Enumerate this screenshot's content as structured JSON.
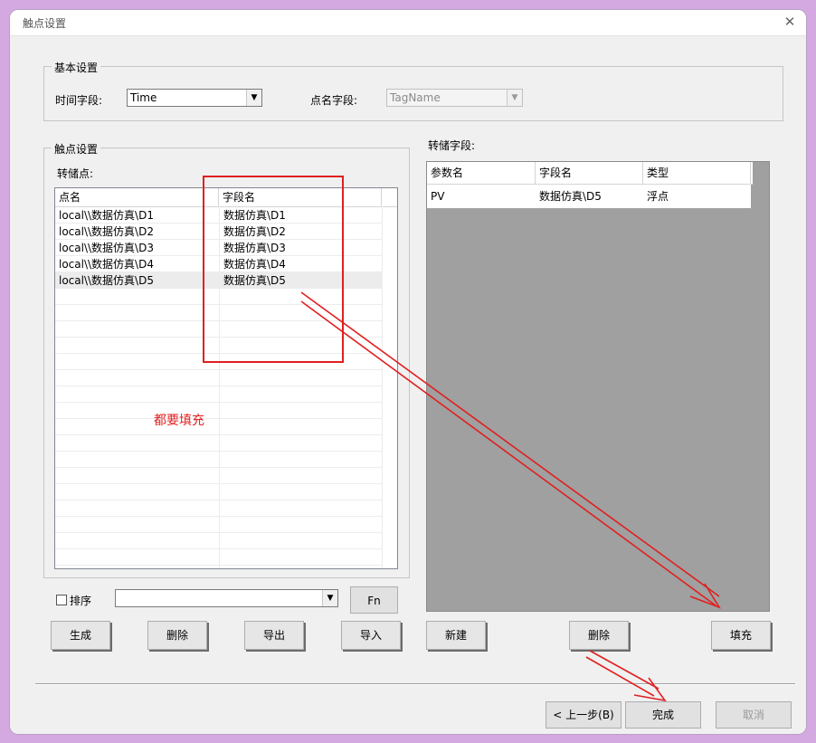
{
  "window": {
    "title": "触点设置",
    "close_glyph": "✕"
  },
  "basic": {
    "group_label": "基本设置",
    "time_field_label": "时间字段:",
    "time_field_value": "Time",
    "point_name_label": "点名字段:",
    "point_name_value": "TagName"
  },
  "points": {
    "group_label": "触点设置",
    "transfer_label": "转储点:",
    "columns": [
      "点名",
      "字段名"
    ],
    "rows": [
      {
        "name": "local\\\\数据仿真\\D1",
        "field": "数据仿真\\D1"
      },
      {
        "name": "local\\\\数据仿真\\D2",
        "field": "数据仿真\\D2"
      },
      {
        "name": "local\\\\数据仿真\\D3",
        "field": "数据仿真\\D3"
      },
      {
        "name": "local\\\\数据仿真\\D4",
        "field": "数据仿真\\D4"
      },
      {
        "name": "local\\\\数据仿真\\D5",
        "field": "数据仿真\\D5"
      }
    ],
    "sort_label": "排序",
    "sort_value": "",
    "fn_button": "Fn",
    "buttons": {
      "generate": "生成",
      "delete": "删除",
      "export": "导出",
      "import": "导入"
    }
  },
  "fields": {
    "label": "转储字段:",
    "columns": [
      "参数名",
      "字段名",
      "类型"
    ],
    "rows": [
      {
        "param": "PV",
        "field": "数据仿真\\D5",
        "type": "浮点"
      }
    ],
    "buttons": {
      "new": "新建",
      "delete": "删除",
      "fill": "填充"
    }
  },
  "annotation": {
    "text": "都要填充",
    "color": "#e02020"
  },
  "footer": {
    "back": "< 上一步(B)",
    "finish": "完成",
    "cancel": "取消"
  },
  "colors": {
    "annotation_red": "#e02020",
    "frame_purple": "#d4a8e0",
    "grey_area": "#a0a0a0"
  }
}
